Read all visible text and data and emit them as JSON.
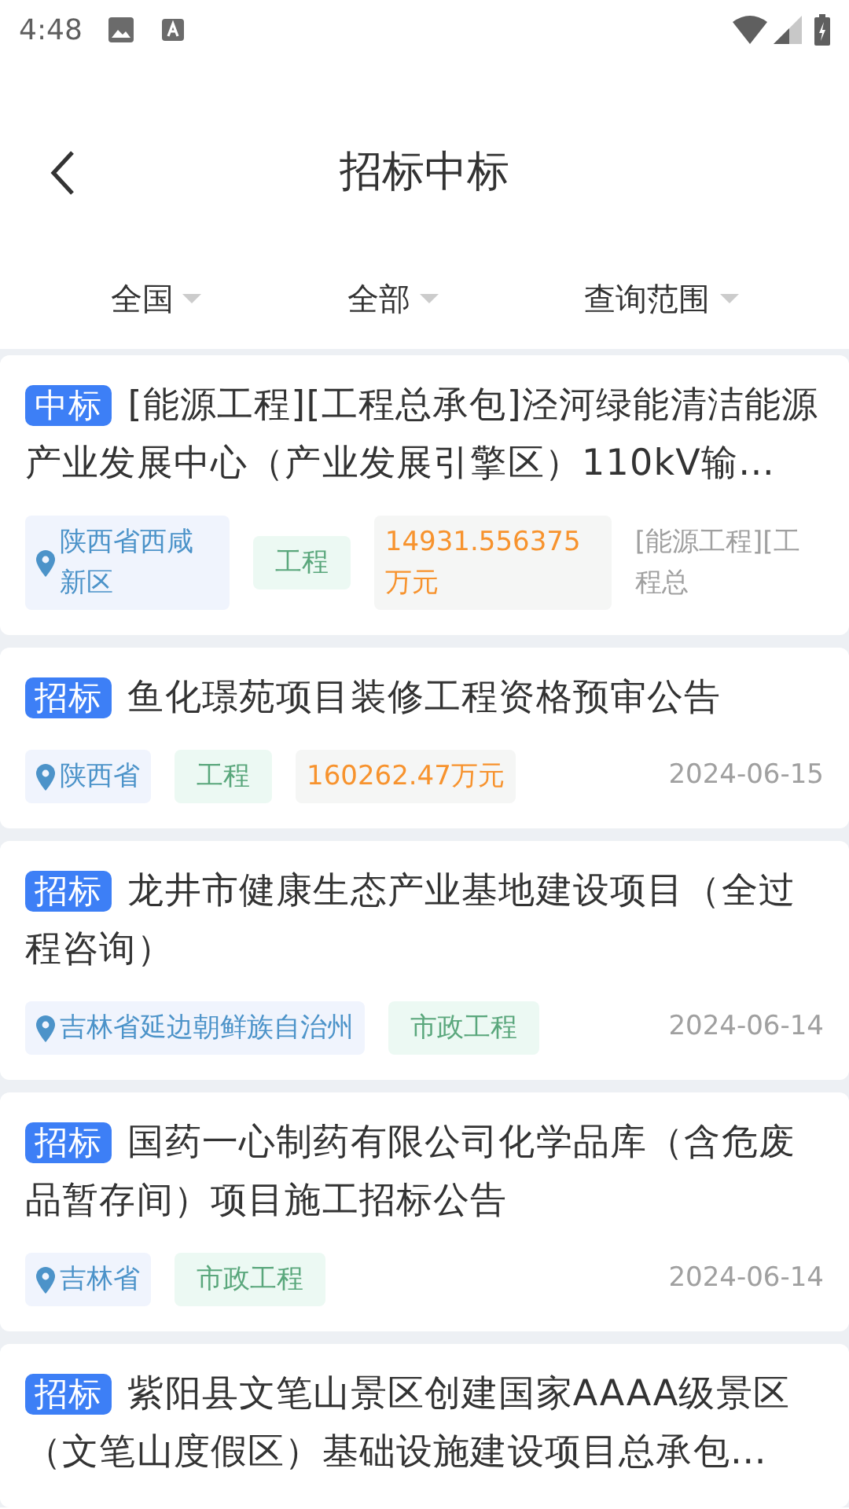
{
  "status_bar": {
    "time": "4:48"
  },
  "header": {
    "title": "招标中标"
  },
  "filters": [
    {
      "label": "全国"
    },
    {
      "label": "全部"
    },
    {
      "label": "查询范围"
    }
  ],
  "cards": [
    {
      "badge": "中标",
      "title": "[能源工程][工程总承包]泾河绿能清洁能源产业发展中心（产业发展引擎区）110kV输…",
      "meta": [
        {
          "kind": "location",
          "text": "陕西省西咸新区"
        },
        {
          "kind": "category",
          "text": "工程"
        },
        {
          "kind": "amount",
          "text": "14931.556375万元"
        },
        {
          "kind": "note",
          "text": "[能源工程][工程总"
        }
      ]
    },
    {
      "badge": "招标",
      "title": "鱼化璟苑项目装修工程资格预审公告",
      "meta": [
        {
          "kind": "location",
          "text": "陕西省"
        },
        {
          "kind": "category",
          "text": "工程"
        },
        {
          "kind": "amount",
          "text": "160262.47万元"
        },
        {
          "kind": "date",
          "text": "2024-06-15"
        }
      ]
    },
    {
      "badge": "招标",
      "title": "龙井市健康生态产业基地建设项目（全过程咨询）",
      "meta": [
        {
          "kind": "location",
          "text": "吉林省延边朝鲜族自治州"
        },
        {
          "kind": "category",
          "text": "市政工程"
        },
        {
          "kind": "date",
          "text": "2024-06-14"
        }
      ]
    },
    {
      "badge": "招标",
      "title": "国药一心制药有限公司化学品库（含危废品暂存间）项目施工招标公告",
      "meta": [
        {
          "kind": "location",
          "text": "吉林省"
        },
        {
          "kind": "category",
          "text": "市政工程"
        },
        {
          "kind": "date",
          "text": "2024-06-14"
        }
      ]
    },
    {
      "badge": "招标",
      "title": "紫阳县文笔山景区创建国家AAAA级景区（文笔山度假区）基础设施建设项目总承包…"
    }
  ]
}
